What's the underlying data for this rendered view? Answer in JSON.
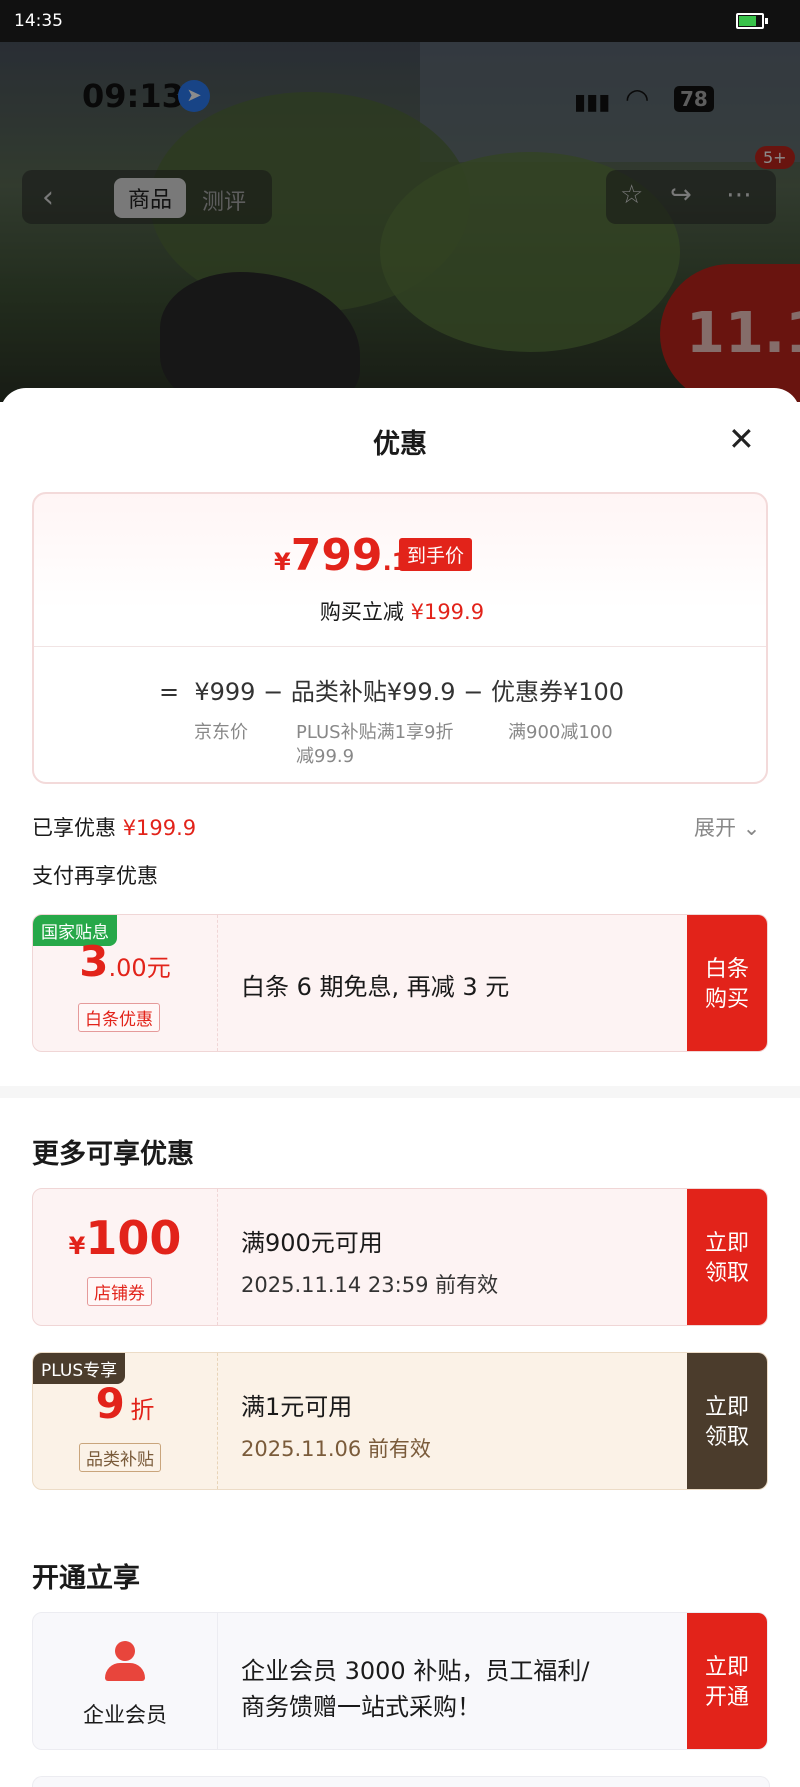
{
  "status_bar": {
    "time": "14:35"
  },
  "background_app": {
    "phone_time": "09:13",
    "battery": "78",
    "tabs": [
      "商品",
      "测评"
    ],
    "badge": "5+"
  },
  "sheet": {
    "title": "优惠",
    "price": {
      "currency": "¥",
      "integer": "799",
      "decimal": ".1",
      "tag": "到手价"
    },
    "reduce": {
      "label": "购买立减",
      "amount": "¥199.9"
    },
    "formula": {
      "equals": "=",
      "jd_price": "¥999",
      "minus": "−",
      "subsidy": "品类补贴¥99.9",
      "coupon": "优惠券¥100",
      "jd_price_label": "京东价",
      "subsidy_desc_line1": "PLUS补贴满1享9折",
      "subsidy_desc_line2": "减99.9",
      "coupon_desc": "满900减100"
    },
    "enjoyed": {
      "label": "已享优惠",
      "amount": "¥199.9"
    },
    "expand_label": "展开",
    "pay_again": "支付再享优惠"
  },
  "coupons": {
    "baitiao": {
      "corner": "国家贴息",
      "amount_int": "3",
      "amount_dec": ".00元",
      "tag": "白条优惠",
      "desc": "白条 6 期免息, 再减 3 元",
      "button": [
        "白条",
        "购买"
      ]
    },
    "more_title": "更多可享优惠",
    "store": {
      "currency": "¥",
      "amount": "100",
      "tag": "店铺券",
      "line1": "满900元可用",
      "line2": "2025.11.14 23:59 前有效",
      "button": [
        "立即",
        "领取"
      ]
    },
    "plus": {
      "corner": "PLUS专享",
      "amount": "9",
      "unit": "折",
      "tag": "品类补贴",
      "line1": "满1元可用",
      "line2": "2025.11.06 前有效",
      "button": [
        "立即",
        "领取"
      ]
    },
    "open_title": "开通立享",
    "member": {
      "label": "企业会员",
      "line1": "企业会员 3000 补贴，员工福利/",
      "line2": "商务馈赠一站式采购！",
      "button": [
        "立即",
        "开通"
      ]
    }
  },
  "colors": {
    "accent": "#e2231a",
    "plus_dark": "#4b3c2c"
  }
}
